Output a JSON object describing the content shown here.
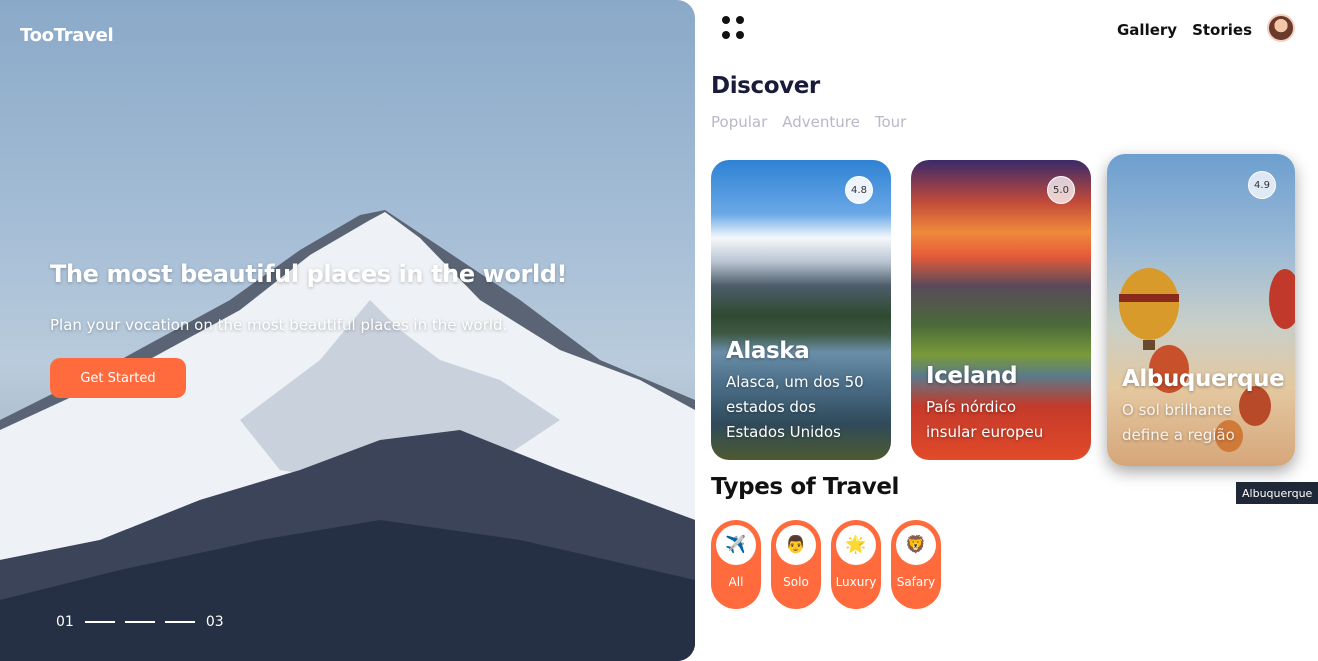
{
  "hero": {
    "brand": "TooTravel",
    "headline": "The most beautiful places in the world!",
    "subline": "Plan your vocation on the most beautiful places in the world.",
    "cta_label": "Get Started",
    "pager": {
      "start": "01",
      "end": "03"
    }
  },
  "nav": {
    "links": [
      "Gallery",
      "Stories"
    ]
  },
  "discover": {
    "title": "Discover",
    "tabs": [
      "Popular",
      "Adventure",
      "Tour"
    ],
    "cards": [
      {
        "title": "Alaska",
        "desc_lines": [
          "Alasca, um dos 50",
          "estados dos",
          "Estados Unidos"
        ],
        "rating": "4.8"
      },
      {
        "title": "Iceland",
        "desc_lines": [
          "País nórdico",
          "insular europeu"
        ],
        "rating": "5.0"
      },
      {
        "title": "Albuquerque",
        "desc_lines": [
          "O sol brilhante",
          "define a região"
        ],
        "rating": "4.9"
      }
    ],
    "tooltip": "Albuquerque"
  },
  "types": {
    "title": "Types of Travel",
    "items": [
      {
        "label": "All",
        "icon": "airplane-icon",
        "glyph": "✈️"
      },
      {
        "label": "Solo",
        "icon": "person-icon",
        "glyph": "👨"
      },
      {
        "label": "Luxury",
        "icon": "sun-icon",
        "glyph": "🌟"
      },
      {
        "label": "Safary",
        "icon": "lion-icon",
        "glyph": "🦁"
      }
    ]
  },
  "colors": {
    "accent": "#ff6b3d",
    "title_dark": "#1a1a3a",
    "tab_muted": "#b8b8c8"
  }
}
